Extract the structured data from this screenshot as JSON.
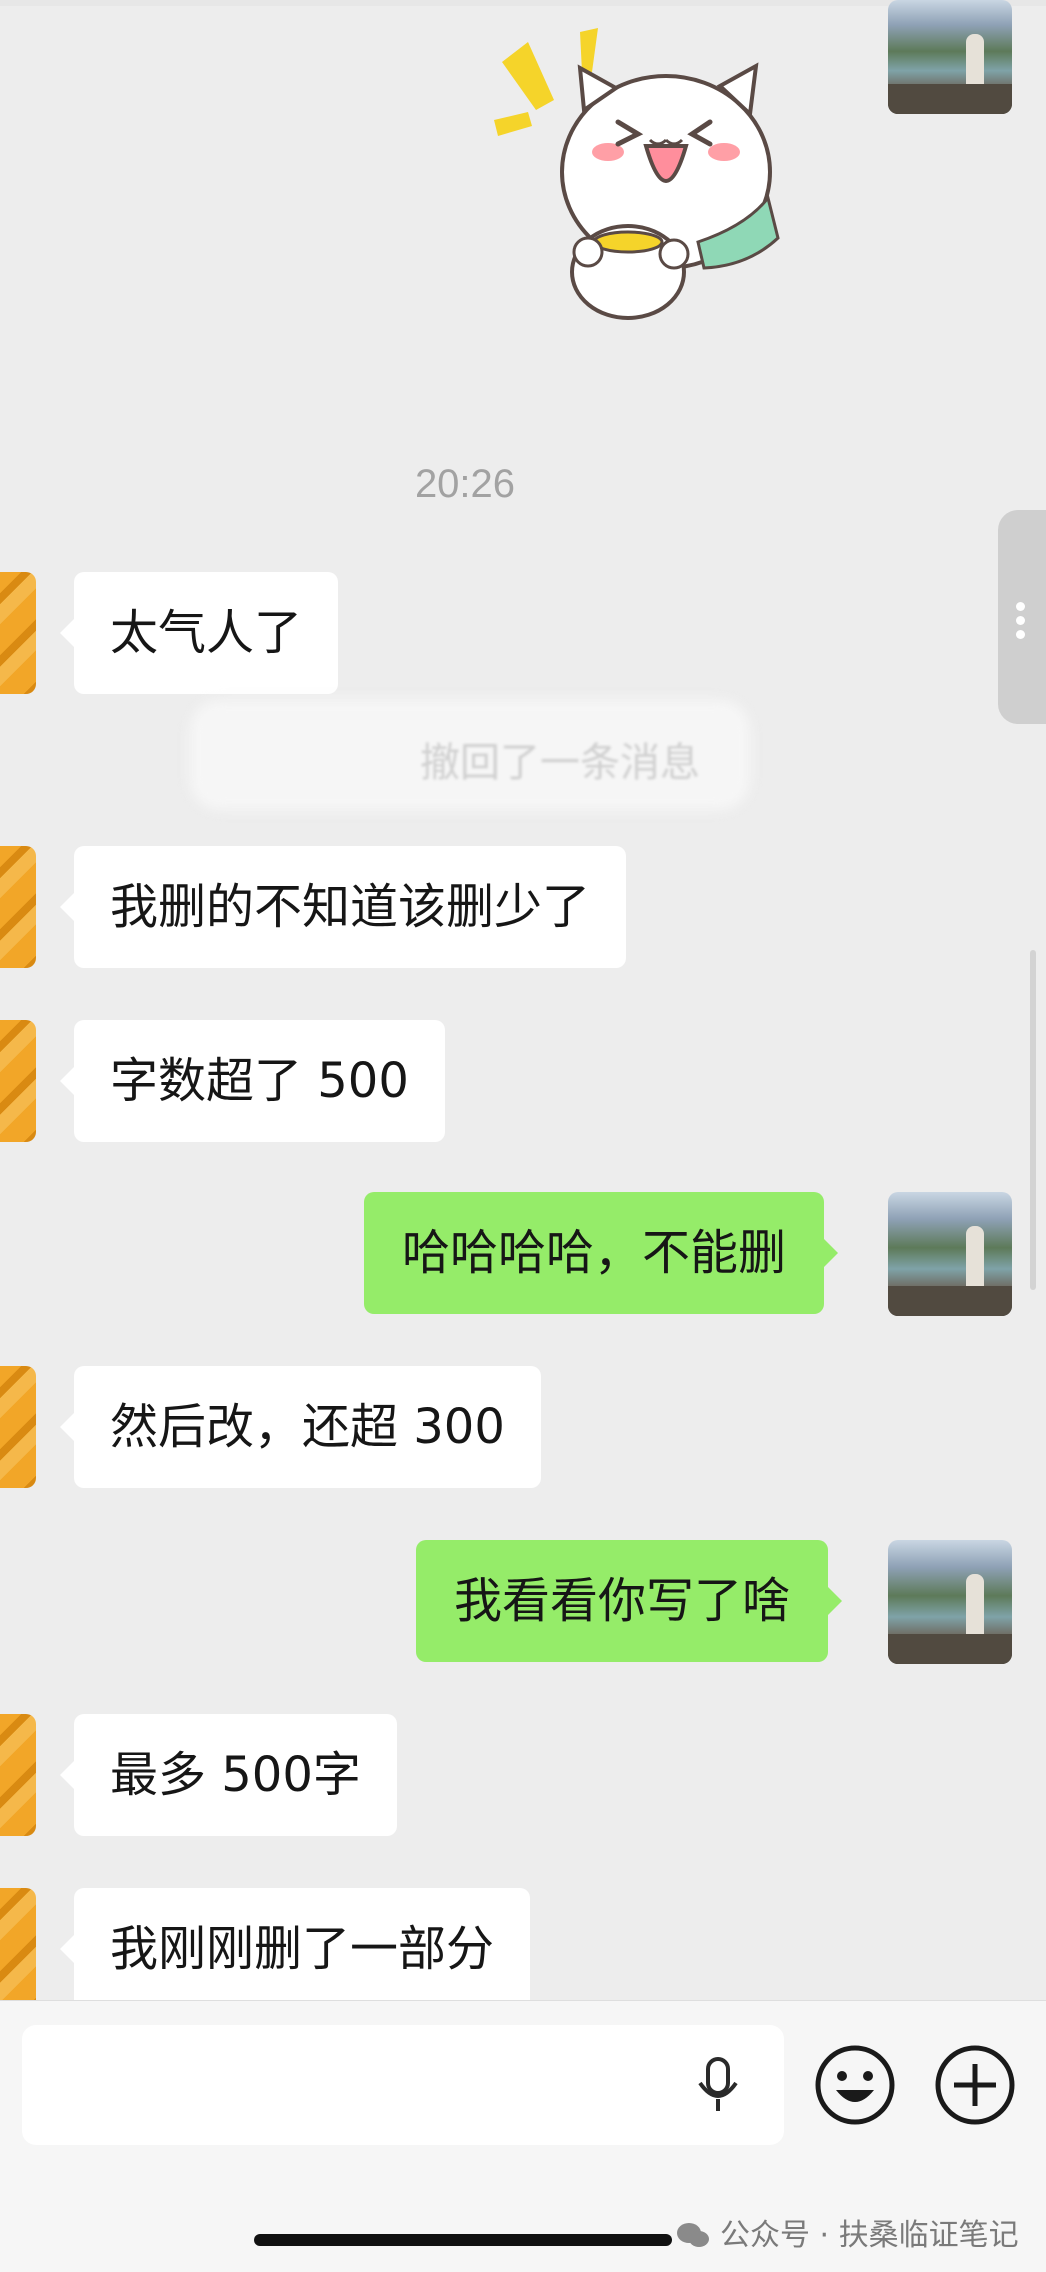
{
  "timestamp": "20:26",
  "messages": [
    {
      "side": "in",
      "text": "太气人了"
    },
    {
      "side": "in",
      "text": "我删的不知道该删少了"
    },
    {
      "side": "in",
      "text": "字数超了 500"
    },
    {
      "side": "out",
      "text": "哈哈哈哈，不能删"
    },
    {
      "side": "in",
      "text": "然后改，还超 300"
    },
    {
      "side": "out",
      "text": "我看看你写了啥"
    },
    {
      "side": "in",
      "text": "最多 500字"
    },
    {
      "side": "in",
      "text": "我刚刚删了一部分"
    }
  ],
  "recall_notice": "撤回了一条消息",
  "input": {
    "placeholder": ""
  },
  "icons": [
    "sticker-cat",
    "voice-mic-icon",
    "emoji-face-icon",
    "plus-icon",
    "wechat-logo-icon"
  ],
  "watermark": "公众号 · 扶桑临证笔记",
  "colors": {
    "background": "#ededed",
    "bubble_in": "#ffffff",
    "bubble_out": "#95ec69",
    "timestamp": "#a2a2a2"
  }
}
